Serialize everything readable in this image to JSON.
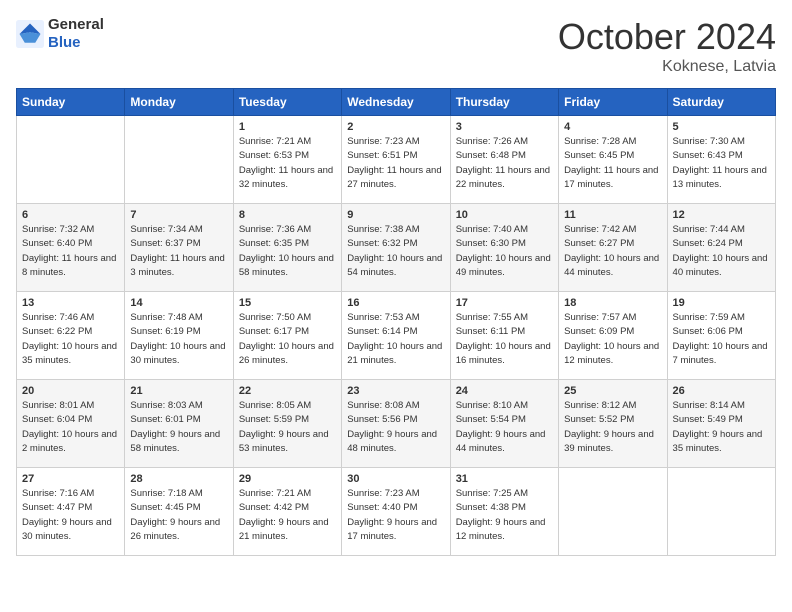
{
  "header": {
    "logo": {
      "general": "General",
      "blue": "Blue"
    },
    "title": "October 2024",
    "location": "Koknese, Latvia"
  },
  "days_of_week": [
    "Sunday",
    "Monday",
    "Tuesday",
    "Wednesday",
    "Thursday",
    "Friday",
    "Saturday"
  ],
  "weeks": [
    [
      {
        "day": "",
        "sunrise": "",
        "sunset": "",
        "daylight": ""
      },
      {
        "day": "",
        "sunrise": "",
        "sunset": "",
        "daylight": ""
      },
      {
        "day": "1",
        "sunrise": "Sunrise: 7:21 AM",
        "sunset": "Sunset: 6:53 PM",
        "daylight": "Daylight: 11 hours and 32 minutes."
      },
      {
        "day": "2",
        "sunrise": "Sunrise: 7:23 AM",
        "sunset": "Sunset: 6:51 PM",
        "daylight": "Daylight: 11 hours and 27 minutes."
      },
      {
        "day": "3",
        "sunrise": "Sunrise: 7:26 AM",
        "sunset": "Sunset: 6:48 PM",
        "daylight": "Daylight: 11 hours and 22 minutes."
      },
      {
        "day": "4",
        "sunrise": "Sunrise: 7:28 AM",
        "sunset": "Sunset: 6:45 PM",
        "daylight": "Daylight: 11 hours and 17 minutes."
      },
      {
        "day": "5",
        "sunrise": "Sunrise: 7:30 AM",
        "sunset": "Sunset: 6:43 PM",
        "daylight": "Daylight: 11 hours and 13 minutes."
      }
    ],
    [
      {
        "day": "6",
        "sunrise": "Sunrise: 7:32 AM",
        "sunset": "Sunset: 6:40 PM",
        "daylight": "Daylight: 11 hours and 8 minutes."
      },
      {
        "day": "7",
        "sunrise": "Sunrise: 7:34 AM",
        "sunset": "Sunset: 6:37 PM",
        "daylight": "Daylight: 11 hours and 3 minutes."
      },
      {
        "day": "8",
        "sunrise": "Sunrise: 7:36 AM",
        "sunset": "Sunset: 6:35 PM",
        "daylight": "Daylight: 10 hours and 58 minutes."
      },
      {
        "day": "9",
        "sunrise": "Sunrise: 7:38 AM",
        "sunset": "Sunset: 6:32 PM",
        "daylight": "Daylight: 10 hours and 54 minutes."
      },
      {
        "day": "10",
        "sunrise": "Sunrise: 7:40 AM",
        "sunset": "Sunset: 6:30 PM",
        "daylight": "Daylight: 10 hours and 49 minutes."
      },
      {
        "day": "11",
        "sunrise": "Sunrise: 7:42 AM",
        "sunset": "Sunset: 6:27 PM",
        "daylight": "Daylight: 10 hours and 44 minutes."
      },
      {
        "day": "12",
        "sunrise": "Sunrise: 7:44 AM",
        "sunset": "Sunset: 6:24 PM",
        "daylight": "Daylight: 10 hours and 40 minutes."
      }
    ],
    [
      {
        "day": "13",
        "sunrise": "Sunrise: 7:46 AM",
        "sunset": "Sunset: 6:22 PM",
        "daylight": "Daylight: 10 hours and 35 minutes."
      },
      {
        "day": "14",
        "sunrise": "Sunrise: 7:48 AM",
        "sunset": "Sunset: 6:19 PM",
        "daylight": "Daylight: 10 hours and 30 minutes."
      },
      {
        "day": "15",
        "sunrise": "Sunrise: 7:50 AM",
        "sunset": "Sunset: 6:17 PM",
        "daylight": "Daylight: 10 hours and 26 minutes."
      },
      {
        "day": "16",
        "sunrise": "Sunrise: 7:53 AM",
        "sunset": "Sunset: 6:14 PM",
        "daylight": "Daylight: 10 hours and 21 minutes."
      },
      {
        "day": "17",
        "sunrise": "Sunrise: 7:55 AM",
        "sunset": "Sunset: 6:11 PM",
        "daylight": "Daylight: 10 hours and 16 minutes."
      },
      {
        "day": "18",
        "sunrise": "Sunrise: 7:57 AM",
        "sunset": "Sunset: 6:09 PM",
        "daylight": "Daylight: 10 hours and 12 minutes."
      },
      {
        "day": "19",
        "sunrise": "Sunrise: 7:59 AM",
        "sunset": "Sunset: 6:06 PM",
        "daylight": "Daylight: 10 hours and 7 minutes."
      }
    ],
    [
      {
        "day": "20",
        "sunrise": "Sunrise: 8:01 AM",
        "sunset": "Sunset: 6:04 PM",
        "daylight": "Daylight: 10 hours and 2 minutes."
      },
      {
        "day": "21",
        "sunrise": "Sunrise: 8:03 AM",
        "sunset": "Sunset: 6:01 PM",
        "daylight": "Daylight: 9 hours and 58 minutes."
      },
      {
        "day": "22",
        "sunrise": "Sunrise: 8:05 AM",
        "sunset": "Sunset: 5:59 PM",
        "daylight": "Daylight: 9 hours and 53 minutes."
      },
      {
        "day": "23",
        "sunrise": "Sunrise: 8:08 AM",
        "sunset": "Sunset: 5:56 PM",
        "daylight": "Daylight: 9 hours and 48 minutes."
      },
      {
        "day": "24",
        "sunrise": "Sunrise: 8:10 AM",
        "sunset": "Sunset: 5:54 PM",
        "daylight": "Daylight: 9 hours and 44 minutes."
      },
      {
        "day": "25",
        "sunrise": "Sunrise: 8:12 AM",
        "sunset": "Sunset: 5:52 PM",
        "daylight": "Daylight: 9 hours and 39 minutes."
      },
      {
        "day": "26",
        "sunrise": "Sunrise: 8:14 AM",
        "sunset": "Sunset: 5:49 PM",
        "daylight": "Daylight: 9 hours and 35 minutes."
      }
    ],
    [
      {
        "day": "27",
        "sunrise": "Sunrise: 7:16 AM",
        "sunset": "Sunset: 4:47 PM",
        "daylight": "Daylight: 9 hours and 30 minutes."
      },
      {
        "day": "28",
        "sunrise": "Sunrise: 7:18 AM",
        "sunset": "Sunset: 4:45 PM",
        "daylight": "Daylight: 9 hours and 26 minutes."
      },
      {
        "day": "29",
        "sunrise": "Sunrise: 7:21 AM",
        "sunset": "Sunset: 4:42 PM",
        "daylight": "Daylight: 9 hours and 21 minutes."
      },
      {
        "day": "30",
        "sunrise": "Sunrise: 7:23 AM",
        "sunset": "Sunset: 4:40 PM",
        "daylight": "Daylight: 9 hours and 17 minutes."
      },
      {
        "day": "31",
        "sunrise": "Sunrise: 7:25 AM",
        "sunset": "Sunset: 4:38 PM",
        "daylight": "Daylight: 9 hours and 12 minutes."
      },
      {
        "day": "",
        "sunrise": "",
        "sunset": "",
        "daylight": ""
      },
      {
        "day": "",
        "sunrise": "",
        "sunset": "",
        "daylight": ""
      }
    ]
  ]
}
